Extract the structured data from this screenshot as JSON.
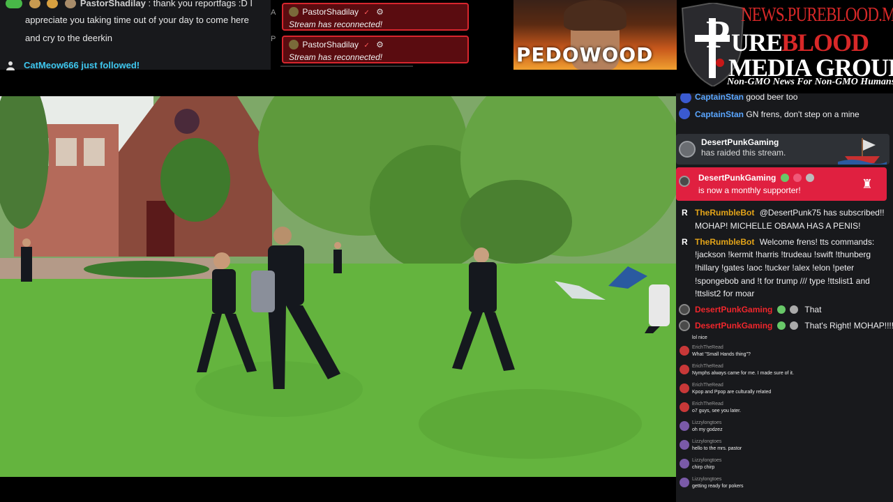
{
  "top_chat": {
    "username": "PastorShadilay",
    "line1": ": thank you reportfags :D I",
    "line2": "appreciate you taking time out of your day to come here",
    "line3": "and cry to the deerkin",
    "follow_text": "CatMeow666 just followed!"
  },
  "mid_gap": {
    "a": "A",
    "b": "P"
  },
  "reconnect_alerts": [
    {
      "user": "PastorShadilay",
      "check": "✓",
      "message": "Stream has reconnected!"
    },
    {
      "user": "PastorShadilay",
      "check": "✓",
      "message": "Stream has reconnected!"
    }
  ],
  "thumbnail": {
    "label": "PEDOWOOD"
  },
  "brand": {
    "url": "NEWS.PUREBLOOD.MEDIA",
    "word_pure": "URE",
    "word_blood": "BLOOD",
    "word_media": "MEDIA GROUP",
    "tagline": "Non-GMO News For Non-GMO Humans"
  },
  "chat": {
    "cut_user": "CaptainStan",
    "cut_msg": "good beer too",
    "stan_user": "CaptainStan",
    "stan_msg": "GN frens, don't step on a mine",
    "raid_user": "DesertPunkGaming",
    "raid_msg": "has raided this stream.",
    "sub_user": "DesertPunkGaming",
    "sub_msg": "is now a monthly supporter!",
    "bot1_user": "TheRumbleBot",
    "bot1_msg_a": "@DesertPunk75 has subscribed!!",
    "bot1_msg_b": "MOHAP! MICHELLE OBAMA HAS A PENIS!",
    "bot2_user": "TheRumbleBot",
    "bot2_msg_a": "Welcome frens! tts commands:",
    "bot2_msg_b": "!jackson !kermit !harris !trudeau !swift !thunberg",
    "bot2_msg_c": "!hillary !gates !aoc !tucker !alex !elon !peter",
    "bot2_msg_d": "!spongebob and !t for trump /// type !ttslist1 and",
    "bot2_msg_e": "!ttslist2 for moar",
    "dp1_user": "DesertPunkGaming",
    "dp1_msg": "That",
    "dp2_user": "DesertPunkGaming",
    "dp2_msg": "That's Right! MOHAP!!!!",
    "r_label": "R"
  },
  "small_chat": {
    "cut_text": "lol nice",
    "items": [
      {
        "user": "ErichTheRead",
        "msg": "What \"Small Hands thing\"?"
      },
      {
        "user": "ErichTheRead",
        "msg": "Nymphs always came for me. I made sure of it."
      },
      {
        "user": "ErichTheRead",
        "msg": "Kpop and Ppop are culturally related"
      },
      {
        "user": "ErichTheRead",
        "msg": "o7 guys, see you later."
      },
      {
        "user": "Lizzylongtoes",
        "msg": "oh my godzez"
      },
      {
        "user": "Lizzylongtoes",
        "msg": "hello to the mrs. pastor"
      },
      {
        "user": "Lizzylongtoes",
        "msg": "chirp chirp"
      },
      {
        "user": "Lizzylongtoes",
        "msg": "getting ready for pokers"
      }
    ]
  },
  "colors": {
    "accent_red": "#e02040",
    "bot_gold": "#e3a419",
    "user_red": "#f0262c",
    "follow_cyan": "#3ec8f0"
  }
}
